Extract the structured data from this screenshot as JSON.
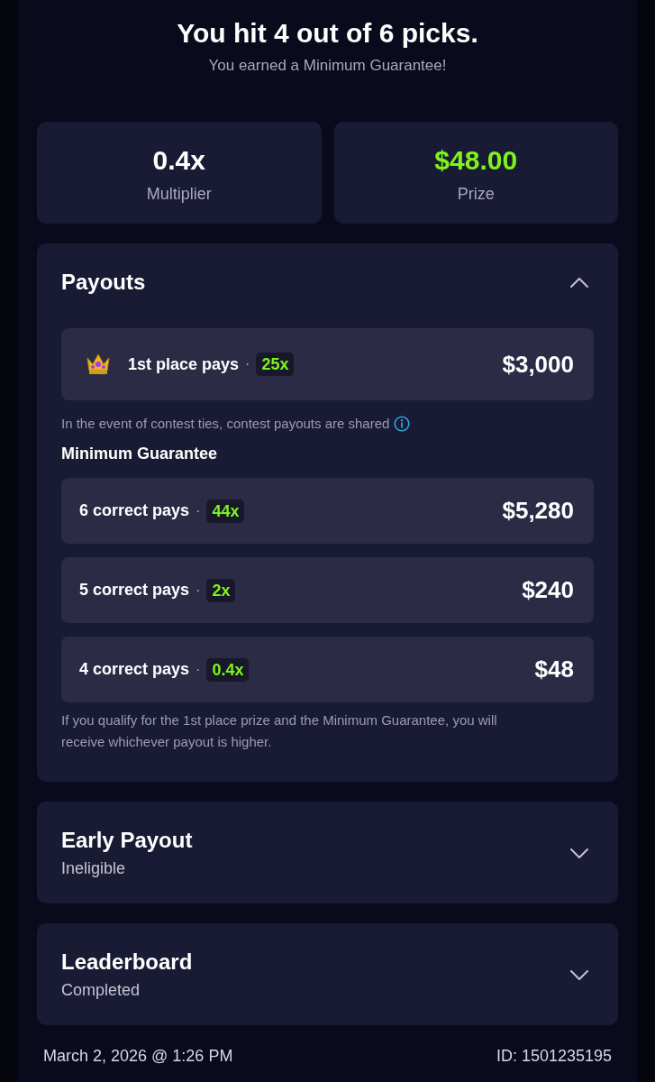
{
  "header": {
    "title": "You hit 4 out of 6 picks.",
    "subtitle": "You earned a Minimum Guarantee!"
  },
  "stats": [
    {
      "value": "0.4x",
      "label": "Multiplier",
      "color": "#ffffff"
    },
    {
      "value": "$48.00",
      "label": "Prize",
      "color": "#7ef31c"
    }
  ],
  "payouts": {
    "title": "Payouts",
    "expanded": true,
    "first_place": {
      "label": "1st place pays",
      "separator": "·",
      "multiplier": "25x",
      "amount": "$3,000"
    },
    "tie_note": "In the event of contest ties, contest payouts are shared",
    "guarantee": {
      "title": "Minimum Guarantee",
      "rows": [
        {
          "label": "6 correct pays",
          "separator": "·",
          "multiplier": "44x",
          "amount": "$5,280"
        },
        {
          "label": "5 correct pays",
          "separator": "·",
          "multiplier": "2x",
          "amount": "$240"
        },
        {
          "label": "4 correct pays",
          "separator": "·",
          "multiplier": "0.4x",
          "amount": "$48"
        }
      ]
    },
    "footnote": "If you qualify for the 1st place prize and the Minimum Guarantee, you will receive whichever payout is higher."
  },
  "sections": [
    {
      "title": "Early Payout",
      "status": "Ineligible",
      "expanded": false
    },
    {
      "title": "Leaderboard",
      "status": "Completed",
      "expanded": false
    }
  ],
  "footer": {
    "timestamp": "March 2, 2026 @ 1:26 PM",
    "id": "ID: 1501235195"
  }
}
